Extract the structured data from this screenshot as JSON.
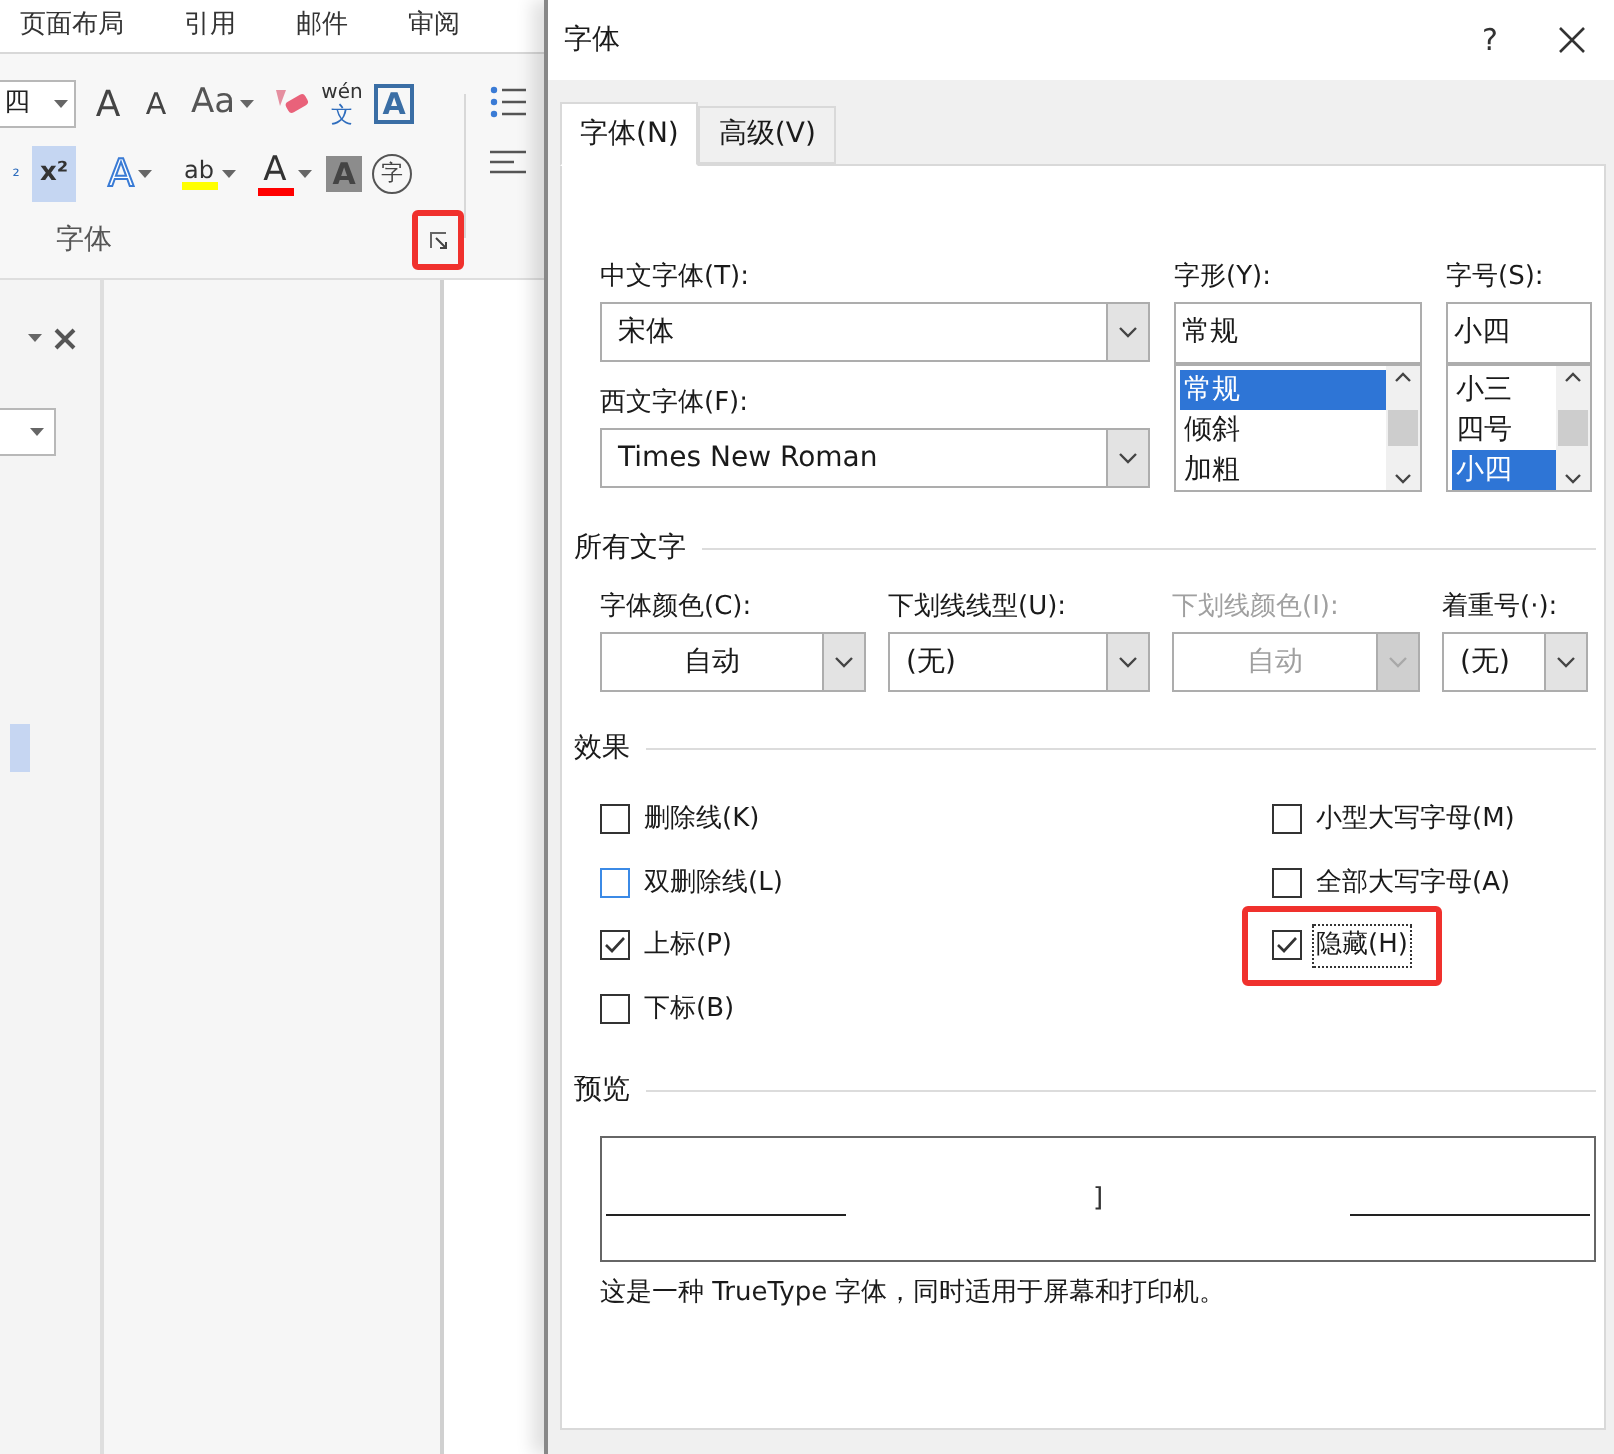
{
  "ribbon": {
    "tabs": [
      "页面布局",
      "引用",
      "邮件",
      "审阅"
    ],
    "size_value": "四",
    "row1": [
      {
        "kind": "grow",
        "glyph": "A"
      },
      {
        "kind": "shrink",
        "glyph": "A"
      },
      {
        "kind": "case",
        "glyph": "Aa"
      },
      {
        "kind": "eraser"
      },
      {
        "kind": "phonetic",
        "glyph": "wén",
        "sub": "文"
      },
      {
        "kind": "border",
        "glyph": "A"
      }
    ],
    "row2": [
      {
        "kind": "subscript",
        "glyph": "₂",
        "selected": false
      },
      {
        "kind": "superscript",
        "glyph": "x²",
        "selected": true
      },
      {
        "kind": "effects",
        "glyph": "A",
        "selected": false
      },
      {
        "kind": "highlight",
        "glyph": "ab",
        "selected": false
      },
      {
        "kind": "color",
        "glyph": "A",
        "selected": false
      },
      {
        "kind": "shading",
        "glyph": "A",
        "selected": false
      },
      {
        "kind": "enclose",
        "glyph": "字",
        "selected": false
      }
    ],
    "group_label": "字体",
    "launcher_highlighted": true
  },
  "dialog": {
    "title": "字体",
    "help": "?",
    "tabs": [
      {
        "label": "字体(N)",
        "selected": true
      },
      {
        "label": "高级(V)",
        "selected": false
      }
    ],
    "chinese_font": {
      "label": "中文字体(T):",
      "value": "宋体"
    },
    "western_font": {
      "label": "西文字体(F):",
      "value": "Times New Roman"
    },
    "style": {
      "label": "字形(Y):",
      "value": "常规",
      "options": [
        {
          "label": "常规",
          "selected": true
        },
        {
          "label": "倾斜",
          "selected": false
        },
        {
          "label": "加粗",
          "selected": false
        }
      ]
    },
    "size": {
      "label": "字号(S):",
      "value": "小四",
      "options": [
        {
          "label": "小三",
          "selected": false
        },
        {
          "label": "四号",
          "selected": false
        },
        {
          "label": "小四",
          "selected": true
        }
      ]
    },
    "all_text": {
      "title": "所有文字",
      "combos": [
        {
          "label": "字体颜色(C):",
          "value": "自动",
          "disabled": false,
          "centered": true
        },
        {
          "label": "下划线线型(U):",
          "value": "(无)",
          "disabled": false,
          "centered": false
        },
        {
          "label": "下划线颜色(I):",
          "value": "自动",
          "disabled": true,
          "centered": true
        },
        {
          "label": "着重号(·):",
          "value": "(无)",
          "disabled": false,
          "centered": false
        }
      ]
    },
    "effects": {
      "title": "效果",
      "left": [
        {
          "label": "删除线(K)",
          "checked": false,
          "hovered": false,
          "focused": false,
          "highlighted": false
        },
        {
          "label": "双删除线(L)",
          "checked": false,
          "hovered": true,
          "focused": false,
          "highlighted": false
        },
        {
          "label": "上标(P)",
          "checked": true,
          "hovered": false,
          "focused": false,
          "highlighted": false
        },
        {
          "label": "下标(B)",
          "checked": false,
          "hovered": false,
          "focused": false,
          "highlighted": false
        }
      ],
      "right": [
        {
          "label": "小型大写字母(M)",
          "checked": false,
          "hovered": false,
          "focused": false,
          "highlighted": false
        },
        {
          "label": "全部大写字母(A)",
          "checked": false,
          "hovered": false,
          "focused": false,
          "highlighted": false
        },
        {
          "label": "隐藏(H)",
          "checked": true,
          "hovered": false,
          "focused": true,
          "highlighted": true
        }
      ]
    },
    "preview": {
      "title": "预览",
      "sample": "]",
      "note": "这是一种 TrueType 字体，同时适用于屏幕和打印机。"
    }
  }
}
